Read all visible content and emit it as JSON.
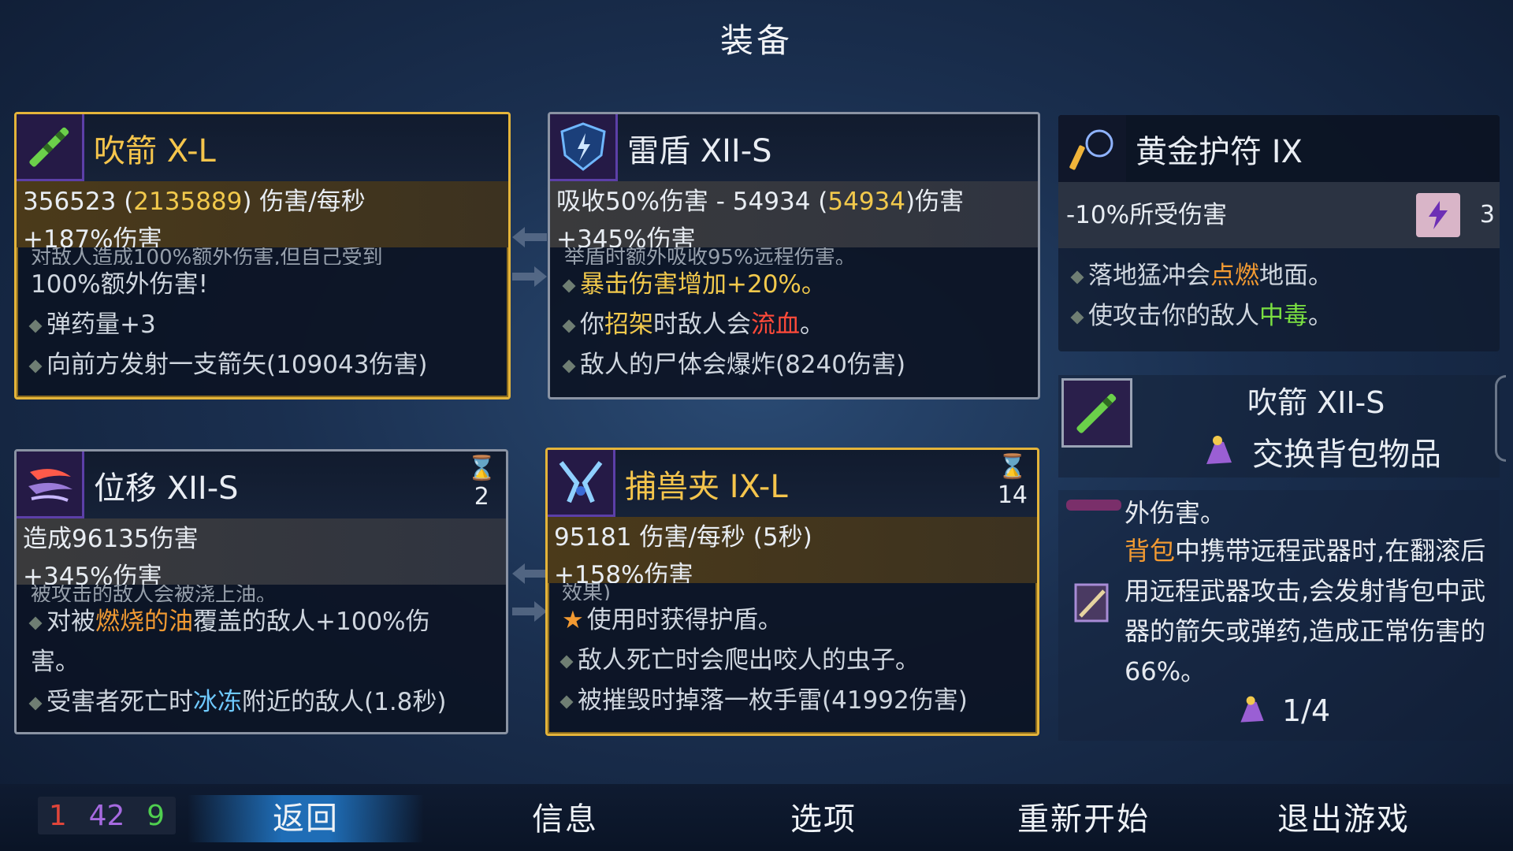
{
  "title": "装备",
  "cards": {
    "blowgun": {
      "name": "吹箭 X-L",
      "stat_dps_main": "356523 (",
      "stat_dps_hl": "2135889",
      "stat_dps_tail": ") 伤害/每秒",
      "stat_bonus": "+187%伤害",
      "cut_line": "对敌人造成100%额外伤害,但自己受到",
      "line1": "100%额外伤害!",
      "line2": "弹药量+3",
      "line3": "向前方发射一支箭矢(109043伤害)"
    },
    "shield": {
      "name": "雷盾 XII-S",
      "stat_main": "吸收50%伤害 - 54934 (",
      "stat_hl": "54934",
      "stat_tail": ")伤害",
      "stat_bonus": "+345%伤害",
      "cut_line": "举盾时额外吸收95%远程伤害。",
      "line1_hl": "暴击伤害增加+20%。",
      "line2_a": "你",
      "line2_b": "招架",
      "line2_c": "时敌人会",
      "line2_d": "流血",
      "line2_e": "。",
      "line3": "敌人的尸体会爆炸(8240伤害)"
    },
    "amulet": {
      "name": "黄金护符 IX",
      "stat": "-10%所受伤害",
      "count": "3",
      "line1_a": "落地猛冲会",
      "line1_b": "点燃",
      "line1_c": "地面。",
      "line2_a": "使攻击你的敌人",
      "line2_b": "中毒",
      "line2_c": "。"
    },
    "dash": {
      "name": "位移 XII-S",
      "cooldown": "2",
      "stat_main": "造成96135伤害",
      "stat_bonus": "+345%伤害",
      "cut_line": "被攻击的敌人会被浇上油。",
      "line1_a": "对被",
      "line1_b": "燃烧的油",
      "line1_c": "覆盖的敌人+100%伤",
      "line1_d": "害。",
      "line2_a": "受害者死亡时",
      "line2_b": "冰冻",
      "line2_c": "附近的敌人(1.8秒)"
    },
    "trap": {
      "name": "捕兽夹 IX-L",
      "cooldown": "14",
      "stat_main": "95181 伤害/每秒 (5秒)",
      "stat_bonus": "+158%伤害",
      "cut_line": "效果)",
      "line1": "使用时获得护盾。",
      "line2": "敌人死亡时会爬出咬人的虫子。",
      "line3": "被摧毁时掉落一枚手雷(41992伤害)"
    }
  },
  "swap": {
    "item_name": "吹箭 XII-S",
    "action": "交换背包物品"
  },
  "side_desc": {
    "cut": "外伤害。",
    "text_a": "背包",
    "text_b": "中携带远程武器时,在翻滚后用远程武器攻击,会发射背包中武器的箭矢或弹药,造成正常伤害的66%。",
    "pages": "1/4"
  },
  "counters": {
    "red": "1",
    "purple": "42",
    "green": "9"
  },
  "menu": {
    "back": "返回",
    "info": "信息",
    "options": "选项",
    "restart": "重新开始",
    "quit": "退出游戏"
  }
}
